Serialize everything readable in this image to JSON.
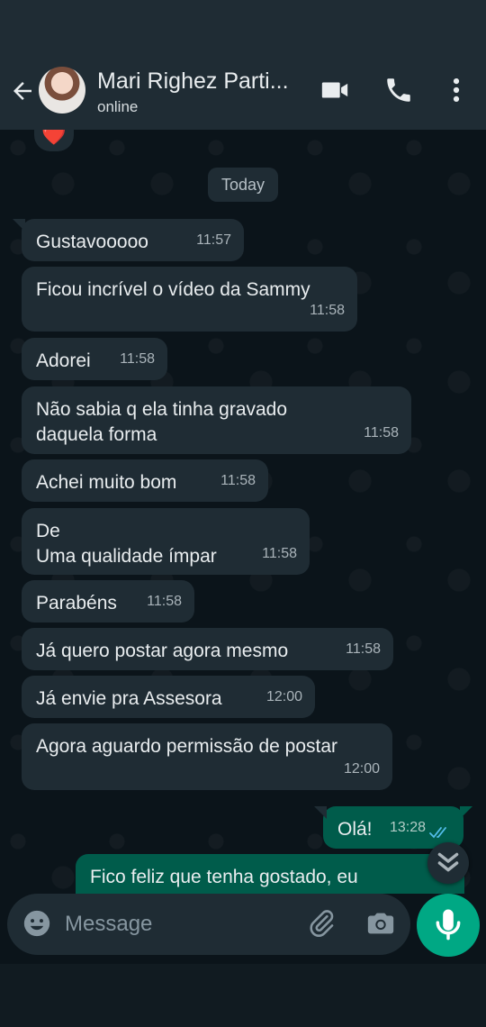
{
  "header": {
    "contact_name": "Mari Righez Parti...",
    "status": "online"
  },
  "chat": {
    "reaction": "❤️",
    "date_chip": "Today",
    "messages": [
      {
        "text": "Gustavooooo",
        "time": "11:57"
      },
      {
        "text": "Ficou incrível o vídeo da Sammy",
        "time": "11:58"
      },
      {
        "text": "Adorei",
        "time": "11:58"
      },
      {
        "text": "Não sabia q ela tinha gravado\ndaquela forma",
        "time": "11:58"
      },
      {
        "text": "Achei muito bom",
        "time": "11:58"
      },
      {
        "text": "De\nUma qualidade ímpar",
        "time": "11:58"
      },
      {
        "text": "Parabéns",
        "time": "11:58"
      },
      {
        "text": "Já quero postar agora mesmo",
        "time": "11:58"
      },
      {
        "text": "Já envie pra Assesora",
        "time": "12:00"
      },
      {
        "text": "Agora aguardo permissão de postar",
        "time": "12:00"
      }
    ],
    "outgoing": [
      {
        "text": "Olá!",
        "time": "13:28"
      },
      {
        "text": "Fico feliz que tenha gostado, eu",
        "time": ""
      }
    ]
  },
  "composer": {
    "placeholder": "Message"
  },
  "colors": {
    "background": "#0b141a",
    "bubble_in": "#1f2c34",
    "bubble_out": "#005c4b",
    "accent": "#00a884",
    "read_ticks": "#53bdeb"
  }
}
